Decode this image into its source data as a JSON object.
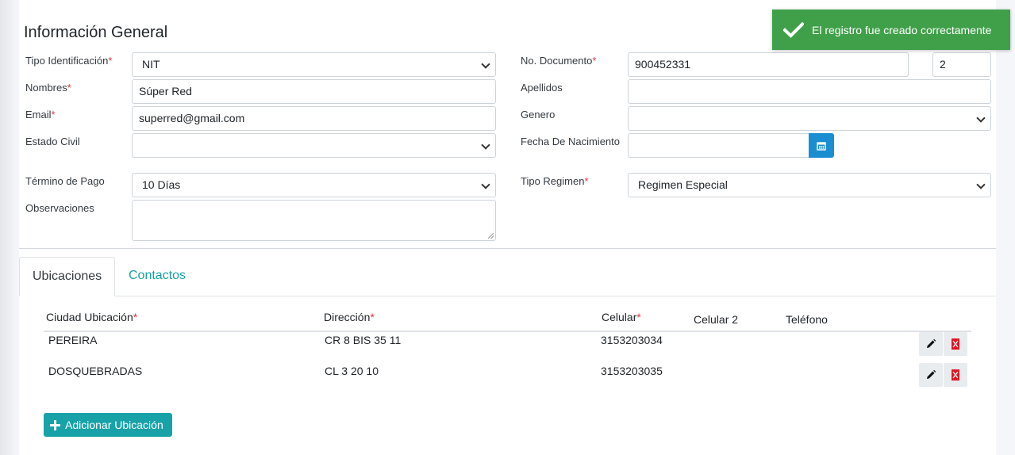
{
  "colors": {
    "accent": "#17a2a8",
    "required": "#dc3545",
    "calendar_button": "#1b8ed1",
    "toast_success": "#40a04a"
  },
  "toast": {
    "message": "El registro fue creado correctamente",
    "icon": "check-icon"
  },
  "section_title": "Información General",
  "form": {
    "tipo_identificacion": {
      "label": "Tipo Identificación",
      "required": "*",
      "value": "NIT"
    },
    "no_documento": {
      "label": "No. Documento",
      "required": "*",
      "value": "900452331",
      "dv_value": "2"
    },
    "nombres": {
      "label": "Nombres",
      "required": "*",
      "value": "Súper Red"
    },
    "apellidos": {
      "label": "Apellidos",
      "value": ""
    },
    "email": {
      "label": "Email",
      "required": "*",
      "value": "superred@gmail.com"
    },
    "genero": {
      "label": "Genero",
      "value": ""
    },
    "estado_civil": {
      "label": "Estado Civil",
      "value": ""
    },
    "fecha_nacimiento": {
      "label": "Fecha De Nacimiento",
      "value": "",
      "icon": "calendar-icon"
    },
    "termino_pago": {
      "label": "Término de Pago",
      "value": "10 Días"
    },
    "tipo_regimen": {
      "label": "Tipo Regimen",
      "required": "*",
      "value": "Regimen Especial"
    },
    "observaciones": {
      "label": "Observaciones",
      "value": ""
    }
  },
  "tabs": [
    {
      "label": "Ubicaciones",
      "active": true
    },
    {
      "label": "Contactos",
      "active": false
    }
  ],
  "table": {
    "columns": [
      {
        "label": "Ciudad Ubicación",
        "required": "*"
      },
      {
        "label": "Dirección",
        "required": "*"
      },
      {
        "label": "Celular",
        "required": "*"
      },
      {
        "label": "Celular 2",
        "required": ""
      },
      {
        "label": "Teléfono",
        "required": ""
      }
    ],
    "rows": [
      {
        "ciudad": "PEREIRA",
        "direccion": "CR 8 BIS 35 11",
        "celular": "3153203034",
        "celular2": "",
        "telefono": ""
      },
      {
        "ciudad": "DOSQUEBRADAS",
        "direccion": "CL 3 20 10",
        "celular": "3153203035",
        "celular2": "",
        "telefono": ""
      }
    ],
    "row_actions": [
      "pencil-icon",
      "delete-icon"
    ]
  },
  "add_button": {
    "label": "Adicionar Ubicación",
    "icon": "plus-icon"
  }
}
